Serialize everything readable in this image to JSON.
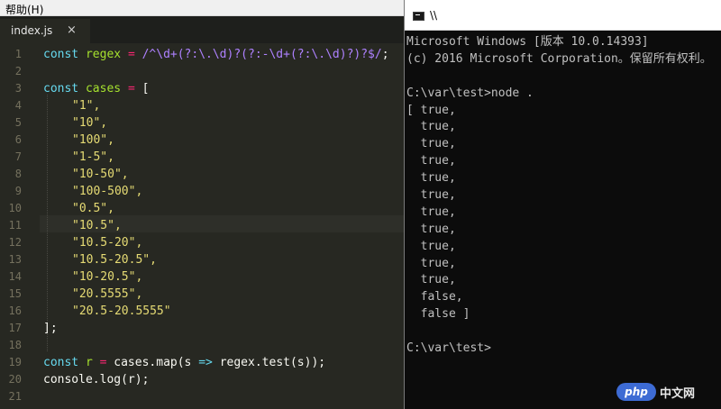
{
  "menubar": {
    "help_label": "帮助(H)"
  },
  "tab": {
    "file_name": "index.js",
    "close_glyph": "×"
  },
  "editor": {
    "line_numbers": [
      "1",
      "2",
      "3",
      "4",
      "5",
      "6",
      "7",
      "8",
      "9",
      "10",
      "11",
      "12",
      "13",
      "14",
      "15",
      "16",
      "17",
      "18",
      "19",
      "20",
      "21"
    ],
    "line1": {
      "kw": "const",
      "name": "regex",
      "eq": "=",
      "regex": "/^\\d+(?:\\.\\d)?(?:-\\d+(?:\\.\\d)?)?$/",
      "semi": ";"
    },
    "line3": {
      "kw": "const",
      "name": "cases",
      "eq": "=",
      "open": "["
    },
    "cases": [
      "\"1\",",
      "\"10\",",
      "\"100\",",
      "\"1-5\",",
      "\"10-50\",",
      "\"100-500\",",
      "\"0.5\",",
      "\"10.5\",",
      "\"10.5-20\",",
      "\"10.5-20.5\",",
      "\"10-20.5\",",
      "\"20.5555\",",
      "\"20.5-20.5555\""
    ],
    "line17": "];",
    "line19": {
      "kw": "const",
      "name": "r",
      "eq": "=",
      "obj": "cases",
      "call": ".map(s",
      "arrow": "=>",
      "rest": "regex.test(s));"
    },
    "line20": "console.log(r);"
  },
  "console": {
    "title": "\\\\",
    "lines": [
      "Microsoft Windows [版本 10.0.14393]",
      "(c) 2016 Microsoft Corporation。保留所有权利。",
      "",
      "C:\\var\\test>node .",
      "[ true,",
      "  true,",
      "  true,",
      "  true,",
      "  true,",
      "  true,",
      "  true,",
      "  true,",
      "  true,",
      "  true,",
      "  true,",
      "  false,",
      "  false ]",
      "",
      "C:\\var\\test>"
    ]
  },
  "watermark": {
    "badge": "php",
    "text": "中文网"
  }
}
